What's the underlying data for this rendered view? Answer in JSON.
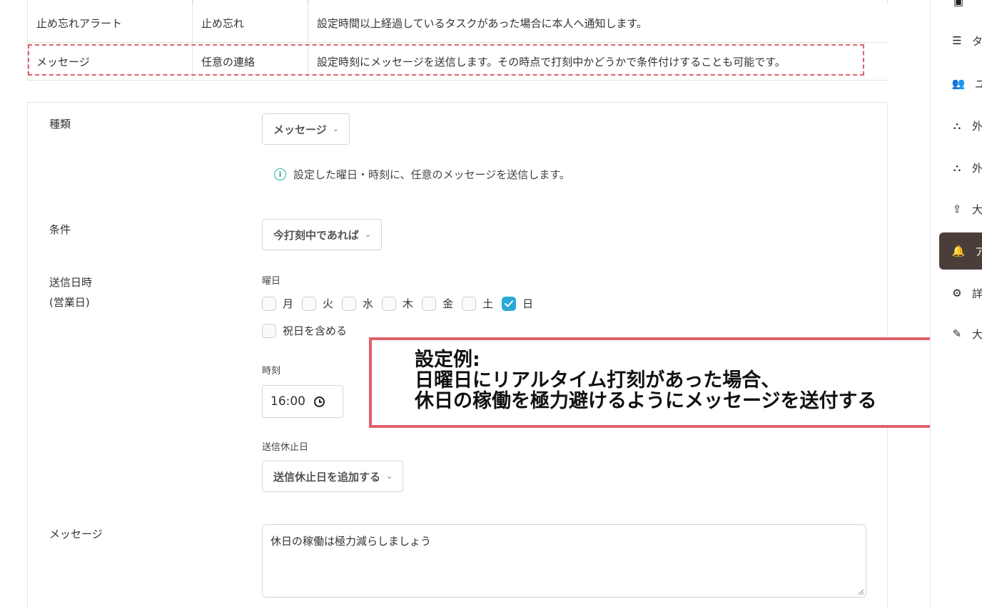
{
  "table": {
    "rows": [
      {
        "name": "止め忘れアラート",
        "type": "止め忘れ",
        "description": "設定時間以上経過しているタスクがあった場合に本人へ通知します。"
      },
      {
        "name": "メッセージ",
        "type": "任意の連絡",
        "description": "設定時刻にメッセージを送信します。その時点で打刻中かどうかで条件付けすることも可能です。"
      }
    ]
  },
  "form": {
    "kind_label": "種類",
    "kind_value": "メッセージ",
    "kind_hint": "設定した曜日・時刻に、任意のメッセージを送信します。",
    "condition_label": "条件",
    "condition_value": "今打刻中であれば",
    "send_label_line1": "送信日時",
    "send_label_line2": "(営業日)",
    "weekday_label": "曜日",
    "weekdays": [
      {
        "label": "月",
        "checked": false
      },
      {
        "label": "火",
        "checked": false
      },
      {
        "label": "水",
        "checked": false
      },
      {
        "label": "木",
        "checked": false
      },
      {
        "label": "金",
        "checked": false
      },
      {
        "label": "土",
        "checked": false
      },
      {
        "label": "日",
        "checked": true
      }
    ],
    "holiday_label": "祝日を含める",
    "time_label": "時刻",
    "time_value": "16:00",
    "pause_label": "送信休止日",
    "pause_button": "送信休止日を追加する",
    "message_label": "メッセージ",
    "message_value": "休日の稼働は極力減らしましょう"
  },
  "callout": {
    "line1": "設定例:",
    "line2": "日曜日にリアルタイム打刻があった場合、",
    "line3": "休日の稼働を極力避けるようにメッセージを送付する"
  },
  "sidebar": {
    "items": [
      {
        "icon": "calendar-icon",
        "label": "",
        "glyph": "▣"
      },
      {
        "icon": "list-icon",
        "label": "タ",
        "glyph": "☰"
      },
      {
        "icon": "users-icon",
        "label": "ユ",
        "glyph": "👥"
      },
      {
        "icon": "org-icon",
        "label": "外",
        "glyph": "⛬"
      },
      {
        "icon": "org-icon",
        "label": "外",
        "glyph": "⛬"
      },
      {
        "icon": "upload-icon",
        "label": "大",
        "glyph": "⇪"
      },
      {
        "icon": "bell-icon",
        "label": "ア",
        "glyph": "🔔",
        "active": true
      },
      {
        "icon": "gear-icon",
        "label": "詳",
        "glyph": "⚙"
      },
      {
        "icon": "pen-icon",
        "label": "大",
        "glyph": "✎"
      }
    ]
  },
  "colors": {
    "highlight": "#e0606c",
    "accent": "#2aa9d6",
    "info": "#2bb3a3",
    "sidebar_active": "#4a3d3a"
  }
}
